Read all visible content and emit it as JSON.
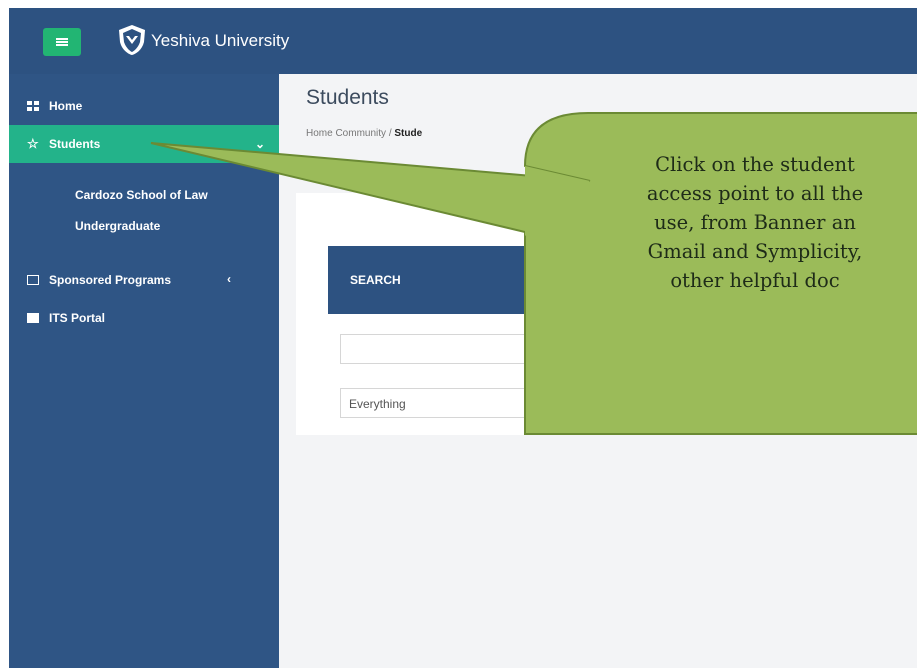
{
  "header": {
    "brand": "Yeshiva University"
  },
  "sidebar": {
    "items": [
      {
        "label": "Home",
        "icon": "grid-icon"
      },
      {
        "label": "Students",
        "icon": "star-icon",
        "active": true
      },
      {
        "label": "Sponsored Programs",
        "icon": "image-icon"
      },
      {
        "label": "ITS Portal",
        "icon": "mail-icon"
      }
    ],
    "subitems": [
      {
        "label": "Cardozo School of Law"
      },
      {
        "label": "Undergraduate"
      }
    ],
    "colors": {
      "background": "#2f5585",
      "active": "#23b38a"
    }
  },
  "main": {
    "title": "Students",
    "breadcrumb": {
      "parent": "Home Community",
      "separator": "/",
      "current": "Stude"
    },
    "search": {
      "heading": "SEARCH",
      "input_value": "",
      "scope_selected": "Everything"
    }
  },
  "callout": {
    "lines": [
      "Click on the student",
      "access point to all the",
      "use, from Banner an",
      "Gmail and Symplicity,",
      "other helpful doc"
    ],
    "fill": "#9bbb59",
    "border": "#6b8a34"
  }
}
